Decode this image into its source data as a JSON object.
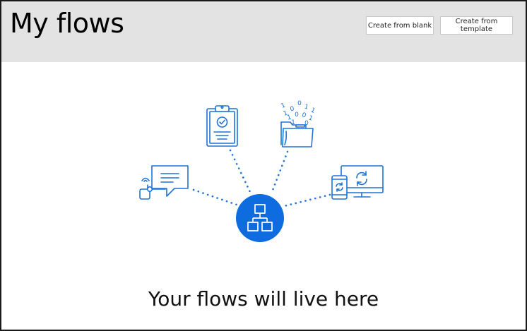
{
  "header": {
    "title": "My flows",
    "buttons": {
      "create_blank": "Create from blank",
      "create_template": "Create from template"
    }
  },
  "empty_state": {
    "title": "Your flows will live here",
    "icons": [
      "chat-notification-icon",
      "clipboard-approval-icon",
      "folder-data-icon",
      "devices-sync-icon",
      "flow-hub-icon"
    ]
  },
  "colors": {
    "header_bg": "#e3e3e3",
    "accent": "#0f6cde",
    "icon_stroke": "#1e72d8"
  }
}
